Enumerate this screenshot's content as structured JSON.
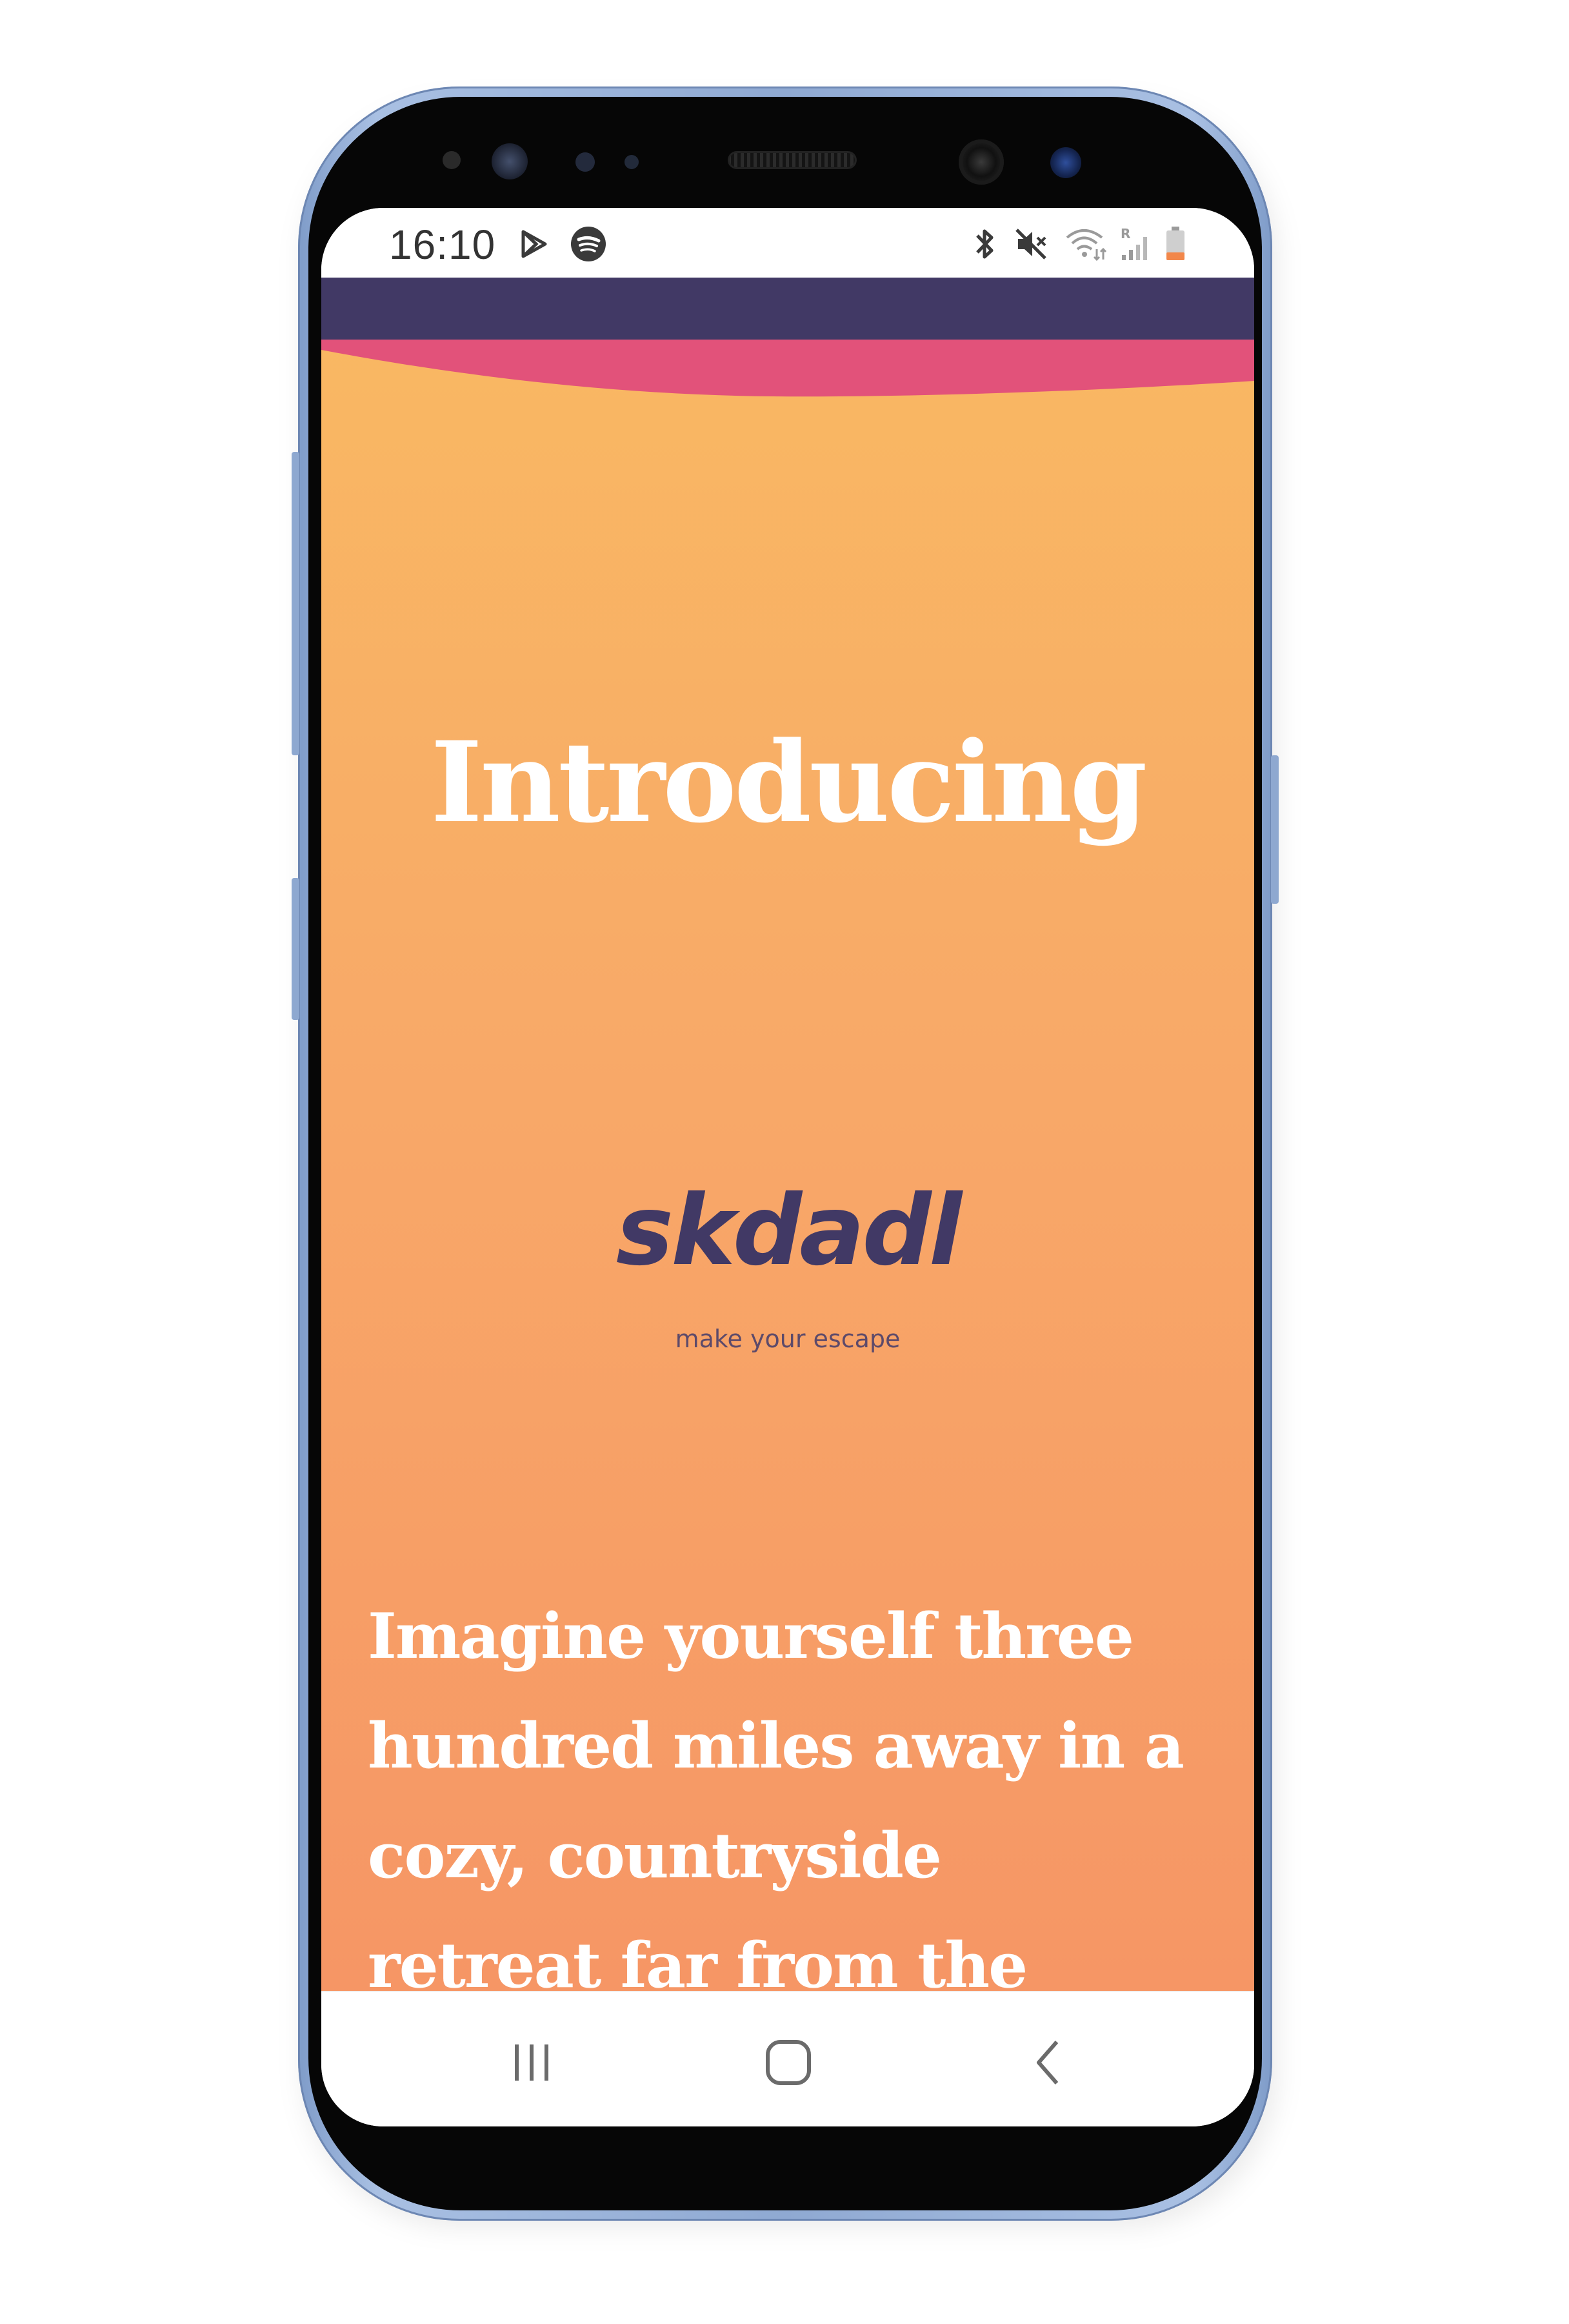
{
  "status_bar": {
    "time": "16:10",
    "left_icons": [
      "play-store-icon",
      "spotify-icon"
    ],
    "right_icons": [
      "bluetooth-icon",
      "mute-icon",
      "wifi-icon",
      "signal-icon",
      "battery-icon"
    ],
    "signal_badge": "R"
  },
  "page": {
    "headline": "Introducing",
    "brand": {
      "name": "skdadl",
      "tagline": "make your escape"
    },
    "intro_text": "Imagine yourself three\nhundred miles away in a\ncozy, countryside\nretreat far from the"
  },
  "nav_bar": {
    "buttons": [
      "recent-apps",
      "home",
      "back"
    ]
  },
  "colors": {
    "top_band": "#413965",
    "wave": "#e2527a",
    "gradient_top": "#f9b962",
    "gradient_bottom": "#f69665",
    "logo": "#413965",
    "phone_frame": "#8fa9d2"
  }
}
